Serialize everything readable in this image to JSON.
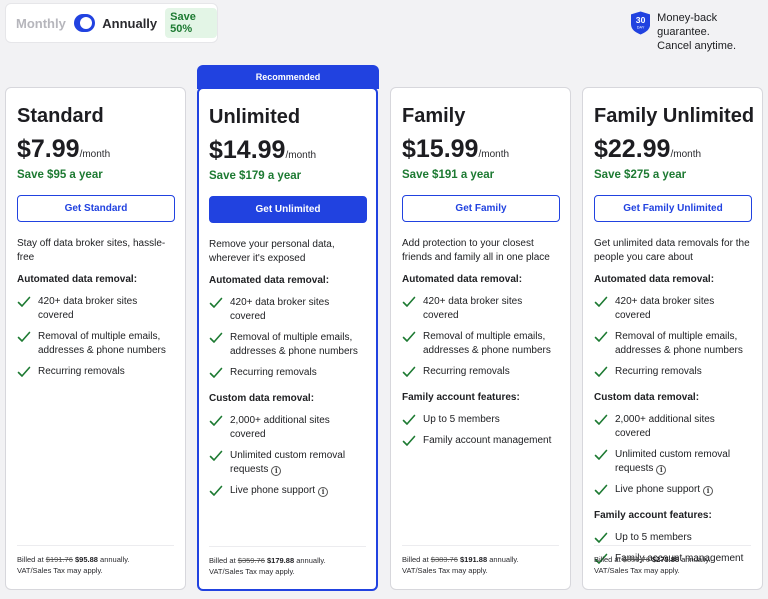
{
  "billing": {
    "monthly_label": "Monthly",
    "annually_label": "Annually",
    "save_badge": "Save 50%",
    "selected": "Annually"
  },
  "guarantee": {
    "badge_number": "30",
    "badge_unit": "DAY",
    "line1": "Money-back guarantee.",
    "line2": "Cancel anytime."
  },
  "colors": {
    "accent": "#2142e0",
    "save_green": "#1d7a32",
    "check_green": "#1d7a32"
  },
  "ribbon": "Recommended",
  "plans": [
    {
      "name": "Standard",
      "price": "$7.99",
      "per": "/month",
      "save": "Save $95 a year",
      "cta": "Get Standard",
      "description": "Stay off data broker sites, hassle-free",
      "sections": [
        {
          "heading": "Automated data removal:",
          "items": [
            "420+ data broker sites covered",
            "Removal of multiple emails, addresses & phone numbers",
            "Recurring removals"
          ]
        }
      ],
      "billed_prefix": "Billed at",
      "billed_old": "$191.76",
      "billed_new": "$95.88",
      "billed_suffix": "annually.",
      "tax_note": "VAT/Sales Tax may apply."
    },
    {
      "name": "Unlimited",
      "price": "$14.99",
      "per": "/month",
      "save": "Save $179 a year",
      "cta": "Get Unlimited",
      "description": "Remove your personal data, wherever it's exposed",
      "sections": [
        {
          "heading": "Automated data removal:",
          "items": [
            "420+ data broker sites covered",
            "Removal of multiple emails, addresses & phone numbers",
            "Recurring removals"
          ]
        },
        {
          "heading": "Custom data removal:",
          "items": [
            "2,000+ additional sites covered",
            "Unlimited custom removal requests",
            "Live phone support"
          ]
        }
      ],
      "billed_prefix": "Billed at",
      "billed_old": "$359.76",
      "billed_new": "$179.88",
      "billed_suffix": "annually.",
      "tax_note": "VAT/Sales Tax may apply."
    },
    {
      "name": "Family",
      "price": "$15.99",
      "per": "/month",
      "save": "Save $191 a year",
      "cta": "Get Family",
      "description": "Add protection to your closest friends and family all in one place",
      "sections": [
        {
          "heading": "Automated data removal:",
          "items": [
            "420+ data broker sites covered",
            "Removal of multiple emails, addresses & phone numbers",
            "Recurring removals"
          ]
        },
        {
          "heading": "Family account features:",
          "items": [
            "Up to 5 members",
            "Family account management"
          ]
        }
      ],
      "billed_prefix": "Billed at",
      "billed_old": "$383.76",
      "billed_new": "$191.88",
      "billed_suffix": "annually.",
      "tax_note": "VAT/Sales Tax may apply."
    },
    {
      "name": "Family Unlimited",
      "price": "$22.99",
      "per": "/month",
      "save": "Save $275 a year",
      "cta": "Get Family Unlimited",
      "description": "Get unlimited data removals for the people you care about",
      "sections": [
        {
          "heading": "Automated data removal:",
          "items": [
            "420+ data broker sites covered",
            "Removal of multiple emails, addresses & phone numbers",
            "Recurring removals"
          ]
        },
        {
          "heading": "Custom data removal:",
          "items": [
            "2,000+ additional sites covered",
            "Unlimited custom removal requests",
            "Live phone support"
          ]
        },
        {
          "heading": "Family account features:",
          "items": [
            "Up to 5 members",
            "Family account management"
          ]
        }
      ],
      "billed_prefix": "Billed at",
      "billed_old": "$551.76",
      "billed_new": "$275.88",
      "billed_suffix": "annually.",
      "tax_note": "VAT/Sales Tax may apply."
    }
  ]
}
